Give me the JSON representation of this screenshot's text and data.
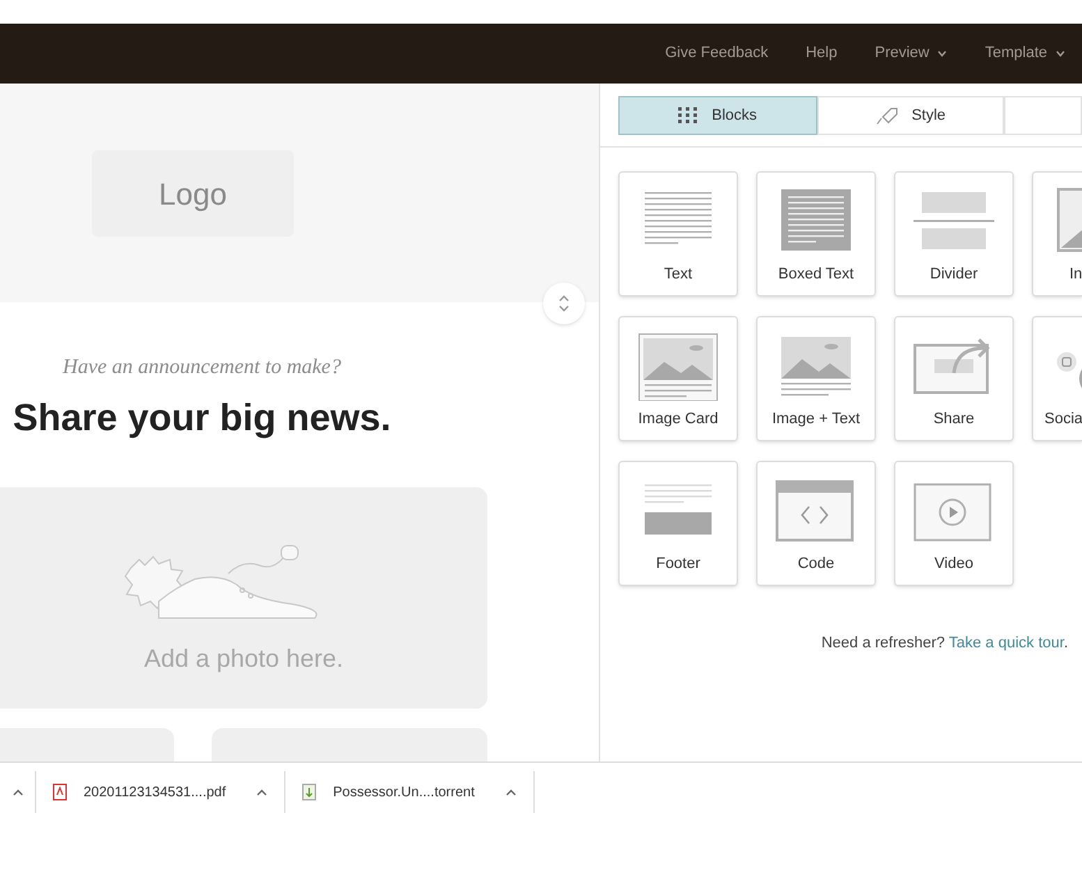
{
  "nav": [
    {
      "label": "Give Feedback",
      "dropdown": false
    },
    {
      "label": "Help",
      "dropdown": false
    },
    {
      "label": "Preview",
      "dropdown": true
    },
    {
      "label": "Template",
      "dropdown": true
    }
  ],
  "tabs": [
    {
      "label": "Blocks",
      "selected": true
    },
    {
      "label": "Style",
      "selected": false
    }
  ],
  "blocks": [
    {
      "label": "Text",
      "kind": "text"
    },
    {
      "label": "Boxed Text",
      "kind": "boxed"
    },
    {
      "label": "Divider",
      "kind": "divider"
    },
    {
      "label": "In",
      "kind": "image"
    },
    {
      "label": "Image Card",
      "kind": "imagecard"
    },
    {
      "label": "Image + Text",
      "kind": "imagetext"
    },
    {
      "label": "Share",
      "kind": "share"
    },
    {
      "label": "Socia",
      "kind": "social"
    },
    {
      "label": "Footer",
      "kind": "footer"
    },
    {
      "label": "Code",
      "kind": "code"
    },
    {
      "label": "Video",
      "kind": "video"
    }
  ],
  "help": {
    "text": "Need a refresher?",
    "link": "Take a quick tour",
    "end": "."
  },
  "canvas": {
    "logo": "Logo",
    "kicker": "Have an announcement to make?",
    "headline": "Share your big news.",
    "photo_hint": "Add a photo here."
  },
  "downloads": [
    {
      "name": "20201123134531....pdf",
      "kind": "pdf"
    },
    {
      "name": "Possessor.Un....torrent",
      "kind": "torrent"
    }
  ]
}
